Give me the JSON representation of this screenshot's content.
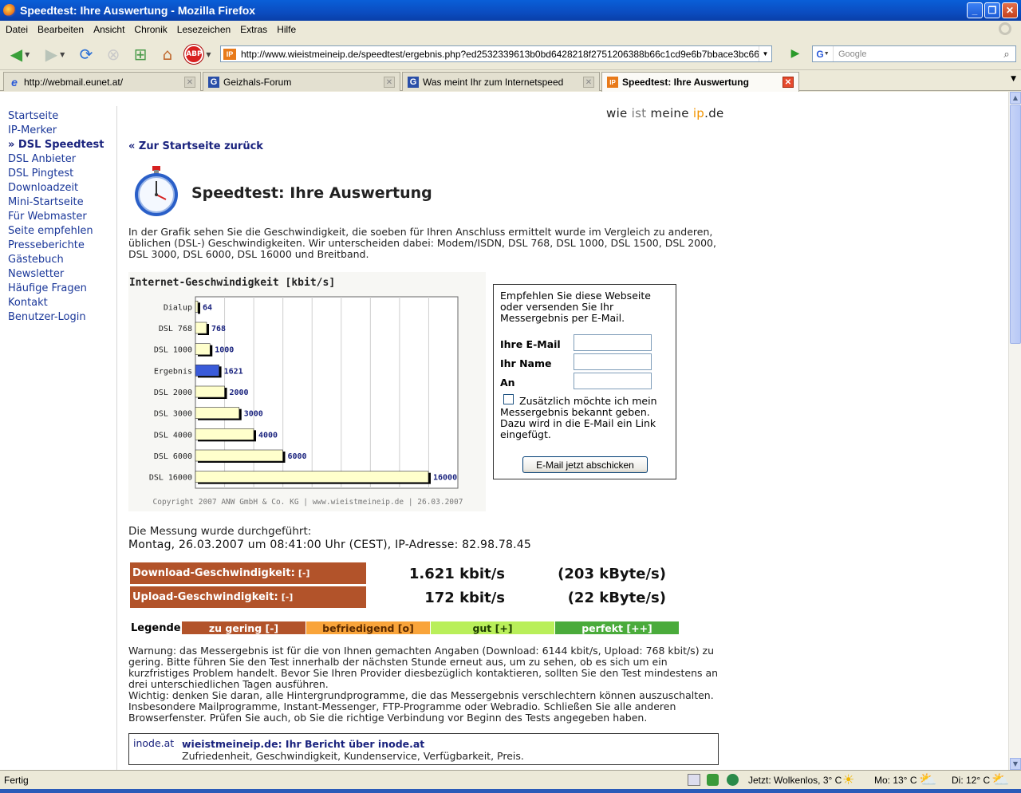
{
  "window": {
    "title": "Speedtest: Ihre Auswertung - Mozilla Firefox"
  },
  "menu": [
    "Datei",
    "Bearbeiten",
    "Ansicht",
    "Chronik",
    "Lesezeichen",
    "Extras",
    "Hilfe"
  ],
  "navbar": {
    "url": "http://www.wieistmeineip.de/speedtest/ergebnis.php?ed2532339613b0bd6428218f2751206388b66c1cd9e6b7bbace3bc6692ef36a8097e",
    "search_placeholder": "Google",
    "abp_label": "ABP"
  },
  "tabs": [
    {
      "label": "http://webmail.eunet.at/",
      "icon": "e-icon",
      "active": false
    },
    {
      "label": "Geizhals-Forum",
      "icon": "g-icon",
      "active": false
    },
    {
      "label": "Was meint Ihr zum Internetspeed",
      "icon": "g-icon",
      "active": false
    },
    {
      "label": "Speedtest: Ihre Auswertung",
      "icon": "ip-icon",
      "active": true
    }
  ],
  "tab_ip_label": "IP",
  "sidebar": {
    "items": [
      "Startseite",
      "IP-Merker",
      "» DSL Speedtest",
      "DSL Anbieter",
      "DSL Pingtest",
      "Downloadzeit",
      "Mini-Startseite",
      "Für Webmaster",
      "Seite empfehlen",
      "Presseberichte",
      "Gästebuch",
      "Newsletter",
      "Häufige Fragen",
      "Kontakt",
      "Benutzer-Login"
    ],
    "current_index": 2
  },
  "logo": {
    "part1": "wie",
    "part2": "ist",
    "part3": "meine",
    "part4": "ip",
    "part5": ".de"
  },
  "page": {
    "back_link": "« Zur Startseite zurück",
    "title": "Speedtest: Ihre Auswertung",
    "intro": "In der Grafik sehen Sie die Geschwindigkeit, die soeben für Ihren Anschluss ermittelt wurde im Vergleich zu anderen, üblichen (DSL-) Geschwindigkeiten. Wir unterscheiden dabei: Modem/ISDN, DSL 768, DSL 1000, DSL 1500, DSL 2000, DSL 3000, DSL 6000, DSL 16000 und Breitband.",
    "measure_line1": "Die Messung wurde durchgeführt:",
    "measure_line2": "Montag, 26.03.2007 um 08:41:00 Uhr (CEST), IP-Adresse: 82.98.78.45",
    "download_label": "Download-Geschwindigkeit:",
    "download_ind": "[-]",
    "download_kbit": "1.621 kbit/s",
    "download_kbyte": "(203 kByte/s)",
    "upload_label": "Upload-Geschwindigkeit:",
    "upload_ind": "[-]",
    "upload_kbit": "172 kbit/s",
    "upload_kbyte": "(22 kByte/s)",
    "legend_label": "Legende:",
    "legend": [
      {
        "label": "zu gering [-]",
        "color": "#b2532a",
        "text_color": "#ffffff"
      },
      {
        "label": "befriedigend [o]",
        "color": "#f9a43a",
        "text_color": "#5a2a00"
      },
      {
        "label": "gut [+]",
        "color": "#b9ef5a",
        "text_color": "#1c3b00"
      },
      {
        "label": "perfekt [++]",
        "color": "#4aab3b",
        "text_color": "#ffffff"
      }
    ],
    "warning": "Warnung: das Messergebnis ist für die von Ihnen gemachten Angaben (Download: 6144 kbit/s, Upload: 768 kbit/s) zu gering. Bitte führen Sie den Test innerhalb der nächsten Stunde erneut aus, um zu sehen, ob es sich um ein kurzfristiges Problem handelt. Bevor Sie Ihren Provider diesbezüglich kontaktieren, sollten Sie den Test mindestens an drei unterschiedlichen Tagen ausführen.",
    "important": "Wichtig: denken Sie daran, alle Hintergrundprogramme, die das Messergebnis verschlechtern können auszuschalten. Insbesondere Mailprogramme, Instant-Messenger, FTP-Programme oder Webradio. Schließen Sie alle anderen Browserfenster. Prüfen Sie auch, ob Sie die richtige Verbindung vor Beginn des Tests angegeben haben.",
    "report_provider": "inode.at",
    "report_title": "wieistmeineip.de: Ihr Bericht über inode.at",
    "report_sub": "Zufriedenheit, Geschwindigkeit, Kundenservice, Verfügbarkeit, Preis."
  },
  "mailbox": {
    "intro": "Empfehlen Sie diese Webseite oder versenden Sie Ihr Messergebnis per E-Mail.",
    "email_label": "Ihre E-Mail",
    "name_label": "Ihr Name",
    "to_label": "An",
    "checkbox_text": "Zusätzlich möchte ich mein Messergebnis bekannt geben. Dazu wird in die E-Mail ein Link eingefügt.",
    "send_button": "E-Mail jetzt abschicken"
  },
  "status": {
    "text": "Fertig",
    "weather_now": "Jetzt: Wolkenlos, 3° C",
    "weather_mo": "Mo: 13° C",
    "weather_di": "Di: 12° C"
  },
  "chart_data": {
    "type": "bar",
    "orientation": "horizontal",
    "title": "Internet-Geschwindigkeit [kbit/s]",
    "categories": [
      "Dialup",
      "DSL 768",
      "DSL 1000",
      "Ergebnis",
      "DSL 2000",
      "DSL 3000",
      "DSL 4000",
      "DSL 6000",
      "DSL 16000"
    ],
    "values": [
      64,
      768,
      1000,
      1621,
      2000,
      3000,
      4000,
      6000,
      16000
    ],
    "highlight_index": 3,
    "bar_color": "#ffffcc",
    "highlight_color": "#3a5bd9",
    "xlim": [
      0,
      16000
    ],
    "grid": true,
    "copyright": "Copyright 2007 ANW GmbH & Co. KG | www.wieistmeineip.de | 26.03.2007"
  }
}
